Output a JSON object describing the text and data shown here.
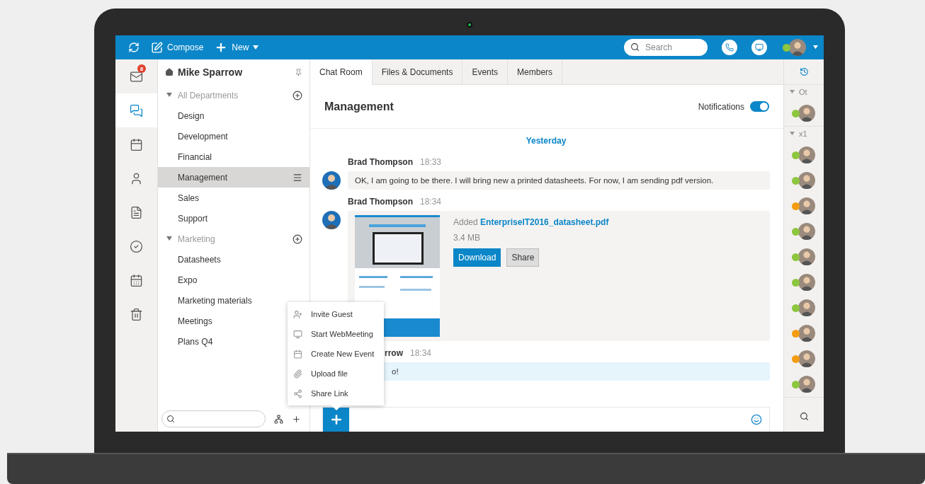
{
  "topbar": {
    "compose": "Compose",
    "new": "New",
    "search": {
      "placeholder": "Search"
    },
    "user": {
      "color": "#8dc63f"
    }
  },
  "rail": [
    {
      "kind": "mail",
      "badge": "8",
      "selected": false
    },
    {
      "kind": "chat",
      "selected": true
    },
    {
      "kind": "calendar",
      "selected": false
    },
    {
      "kind": "contacts",
      "selected": false
    },
    {
      "kind": "notes",
      "selected": false
    },
    {
      "kind": "tasks",
      "selected": false
    },
    {
      "kind": "schedule",
      "selected": false
    },
    {
      "kind": "trash",
      "selected": false
    }
  ],
  "sidebar": {
    "title": "Mike Sparrow",
    "groups": [
      {
        "label": "All Departments",
        "expanded": true,
        "children": [
          {
            "label": "Design",
            "selected": false
          },
          {
            "label": "Development",
            "selected": false
          },
          {
            "label": "Financial",
            "selected": false
          },
          {
            "label": "Management",
            "selected": true
          },
          {
            "label": "Sales",
            "selected": false
          },
          {
            "label": "Support",
            "selected": false
          }
        ]
      },
      {
        "label": "Marketing",
        "expanded": true,
        "children": [
          {
            "label": "Datasheets",
            "selected": false
          },
          {
            "label": "Expo",
            "selected": false
          },
          {
            "label": "Marketing materials",
            "selected": false
          },
          {
            "label": "Meetings",
            "selected": false
          },
          {
            "label": "Plans Q4",
            "selected": false
          }
        ]
      }
    ]
  },
  "tabs": [
    {
      "label": "Chat Room",
      "selected": true
    },
    {
      "label": "Files & Documents",
      "selected": false
    },
    {
      "label": "Events",
      "selected": false
    },
    {
      "label": "Members",
      "selected": false
    }
  ],
  "room": {
    "title": "Management",
    "notifications": {
      "label": "Notifications",
      "on": true
    }
  },
  "chat": {
    "day": "Yesterday",
    "messages": [
      {
        "kind": "text",
        "author": "Brad Thompson",
        "time": "18:33",
        "text": "OK, I am going to be there. I will bring new a printed datasheets. For now, I am sending pdf version."
      },
      {
        "kind": "file",
        "author": "Brad Thompson",
        "time": "18:34",
        "added": "Added",
        "file": "EnterpriseIT2016_datasheet.pdf",
        "size": "3.4 MB",
        "buttons": [
          "Download",
          "Share"
        ]
      },
      {
        "kind": "partial",
        "author": "rrow",
        "time": "18:34",
        "text": "o!"
      }
    ]
  },
  "menu": [
    {
      "kind": "guest",
      "label": "Invite Guest"
    },
    {
      "kind": "meeting",
      "label": "Start WebMeeting"
    },
    {
      "kind": "event",
      "label": "Create New Event"
    },
    {
      "kind": "upload",
      "label": "Upload file"
    },
    {
      "kind": "share",
      "label": "Share Link"
    }
  ],
  "contacts": {
    "groups": [
      {
        "label": "Ot",
        "members": [
          {
            "color": "#8dc63f"
          }
        ]
      },
      {
        "label": "x1",
        "members": [
          {
            "color": "#8dc63f"
          },
          {
            "color": "#8dc63f"
          },
          {
            "color": "#f39c12"
          },
          {
            "color": "#8dc63f"
          },
          {
            "color": "#8dc63f"
          },
          {
            "color": "#8dc63f"
          },
          {
            "color": "#8dc63f"
          },
          {
            "color": "#f39c12"
          },
          {
            "color": "#f39c12"
          },
          {
            "color": "#8dc63f"
          }
        ]
      }
    ]
  }
}
